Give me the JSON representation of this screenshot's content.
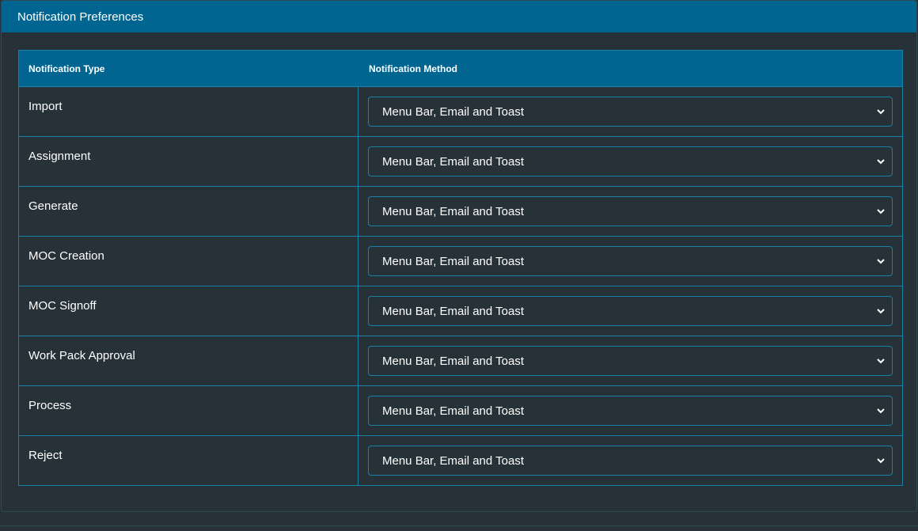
{
  "panel": {
    "title": "Notification Preferences"
  },
  "table": {
    "headers": {
      "type": "Notification Type",
      "method": "Notification Method"
    },
    "rows": [
      {
        "type": "Import",
        "method": "Menu Bar, Email and Toast"
      },
      {
        "type": "Assignment",
        "method": "Menu Bar, Email and Toast"
      },
      {
        "type": "Generate",
        "method": "Menu Bar, Email and Toast"
      },
      {
        "type": "MOC Creation",
        "method": "Menu Bar, Email and Toast"
      },
      {
        "type": "MOC Signoff",
        "method": "Menu Bar, Email and Toast"
      },
      {
        "type": "Work Pack Approval",
        "method": "Menu Bar, Email and Toast"
      },
      {
        "type": "Process",
        "method": "Menu Bar, Email and Toast"
      },
      {
        "type": "Reject",
        "method": "Menu Bar, Email and Toast"
      }
    ]
  },
  "icons": {
    "dropdown": "chevron-down-icon"
  },
  "colors": {
    "header_bg": "#006691",
    "body_bg": "#263238",
    "border": "#1b7fa6",
    "text": "#ffffff"
  }
}
